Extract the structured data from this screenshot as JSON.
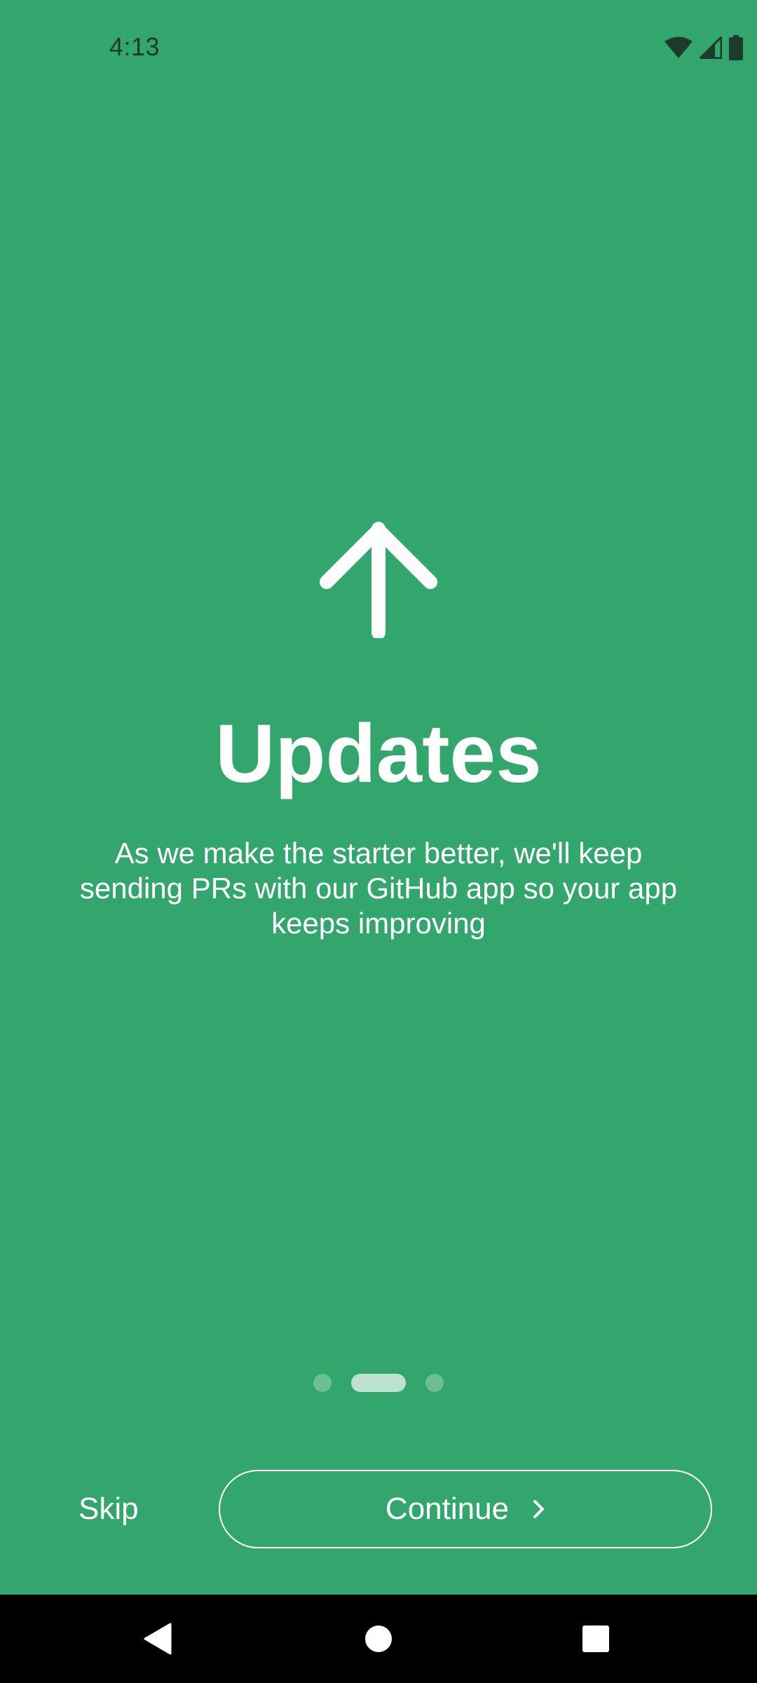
{
  "status_bar": {
    "time": "4:13",
    "icons": [
      "wifi-icon",
      "cell-signal-icon",
      "battery-icon"
    ]
  },
  "onboarding": {
    "icon": "arrow-up-icon",
    "title": "Updates",
    "body": "As we make the starter better, we'll keep sending PRs with our GitHub app so your app keeps improving",
    "pager": {
      "total": 3,
      "active_index": 1
    }
  },
  "actions": {
    "skip_label": "Skip",
    "continue_label": "Continue",
    "continue_icon": "chevron-right-icon"
  },
  "nav_bar": {
    "icons": [
      "back-icon",
      "home-icon",
      "recents-icon"
    ]
  },
  "colors": {
    "background": "#33a66e",
    "foreground": "#ffffff",
    "status_text": "#1c3b2c",
    "nav_bar": "#000000"
  }
}
